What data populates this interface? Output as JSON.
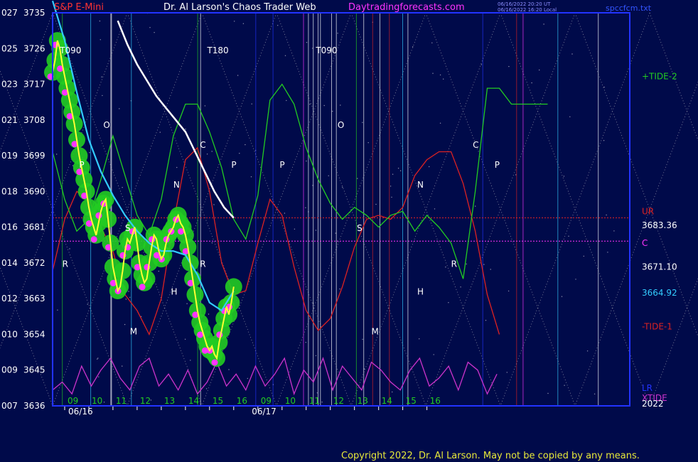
{
  "header": {
    "symbol": "S&P E-Mini",
    "title": "Dr. Al Larson's Chaos Trader Web",
    "site": "Daytradingforecasts.com",
    "stamp_line1": "06/16/2022 20:20 UT",
    "stamp_line2": "06/16/2022 16:20 Local",
    "file": "spccfcm.txt"
  },
  "footer": {
    "copyright": "Copyright 2022, Dr. Al Larson. May not be copied by any means."
  },
  "colors": {
    "background": "#000a4a",
    "plot_border": "#2233ff",
    "price_line": "#ffff33",
    "price_marker": "#ff33ff",
    "price_halo": "#22cc22",
    "ma_cyan": "#33ccff",
    "ma_white": "#ffffff",
    "tide_plus": "#22cc22",
    "tide_minus": "#dd2222",
    "xtide": "#cc33cc"
  },
  "chart_data": {
    "type": "line",
    "title": "S&P E-Mini",
    "xlabel": "",
    "ylabel": "",
    "x_axis": {
      "hour_ticks": [
        "09",
        "10",
        "11",
        "12",
        "13",
        "14",
        "15",
        "16",
        "09",
        "10",
        "11",
        "12",
        "13",
        "14",
        "15",
        "16"
      ],
      "dates": [
        "06/16",
        "06/17"
      ],
      "range_hours": [
        8.5,
        32.4
      ]
    },
    "y_axis": {
      "range": [
        3636,
        3735
      ],
      "ticks": [
        {
          "left": "027",
          "price": "3735",
          "y": 3735
        },
        {
          "left": "025",
          "price": "3726",
          "y": 3726
        },
        {
          "left": "023",
          "price": "3717",
          "y": 3717
        },
        {
          "left": "021",
          "price": "3708",
          "y": 3708
        },
        {
          "left": "019",
          "price": "3699",
          "y": 3699
        },
        {
          "left": "018",
          "price": "3690",
          "y": 3690
        },
        {
          "left": "016",
          "price": "3681",
          "y": 3681
        },
        {
          "left": "014",
          "price": "3672",
          "y": 3672
        },
        {
          "left": "012",
          "price": "3663",
          "y": 3663
        },
        {
          "left": "010",
          "price": "3654",
          "y": 3654
        },
        {
          "left": "009",
          "price": "3645",
          "y": 3645
        },
        {
          "left": "007",
          "price": "3636",
          "y": 3636
        }
      ]
    },
    "grid": false,
    "vertical_markers": [
      {
        "label": "T090",
        "x": 8.8,
        "color": "#ffffff"
      },
      {
        "label": "T180",
        "x": 14.9,
        "color": "#ffffff"
      },
      {
        "label": "T090",
        "x": 19.4,
        "color": "#ffffff"
      }
    ],
    "turn_labels": [
      {
        "label": "O",
        "x": 10.6,
        "y": 3706
      },
      {
        "label": "P",
        "x": 9.6,
        "y": 3696
      },
      {
        "label": "S",
        "x": 11.5,
        "y": 3680
      },
      {
        "label": "N",
        "x": 13.5,
        "y": 3691
      },
      {
        "label": "H",
        "x": 13.4,
        "y": 3664
      },
      {
        "label": "M",
        "x": 11.7,
        "y": 3654
      },
      {
        "label": "R",
        "x": 8.9,
        "y": 3671
      },
      {
        "label": "C",
        "x": 14.6,
        "y": 3701
      },
      {
        "label": "R",
        "x": 14.6,
        "y": 3671
      },
      {
        "label": "P",
        "x": 15.9,
        "y": 3696
      },
      {
        "label": "P",
        "x": 17.9,
        "y": 3696
      },
      {
        "label": "O",
        "x": 20.3,
        "y": 3706
      },
      {
        "label": "S",
        "x": 21.1,
        "y": 3680
      },
      {
        "label": "M",
        "x": 21.7,
        "y": 3654
      },
      {
        "label": "N",
        "x": 23.6,
        "y": 3691
      },
      {
        "label": "H",
        "x": 23.6,
        "y": 3664
      },
      {
        "label": "R",
        "x": 25.0,
        "y": 3671
      },
      {
        "label": "C",
        "x": 25.9,
        "y": 3701
      },
      {
        "label": "P",
        "x": 26.8,
        "y": 3696
      }
    ],
    "right_labels": [
      {
        "label": "+TIDE-2",
        "y": 3719,
        "color": "#22cc22"
      },
      {
        "label": "UR",
        "y": 3685,
        "color": "#dd2222"
      },
      {
        "label": "3683.36",
        "y": 3681.5,
        "color": "#ffffff"
      },
      {
        "label": "C",
        "y": 3677,
        "color": "#ff33ff"
      },
      {
        "label": "3671.10",
        "y": 3671,
        "color": "#ffffff"
      },
      {
        "label": "3664.92",
        "y": 3664.5,
        "color": "#33ccff"
      },
      {
        "label": "-TIDE-1",
        "y": 3656,
        "color": "#dd2222"
      },
      {
        "label": "LR",
        "y": 3640.5,
        "color": "#2233ff"
      },
      {
        "label": "XTIDE",
        "y": 3638,
        "color": "#cc33cc"
      },
      {
        "label": "2022",
        "y": 3636.5,
        "color": "#ffffff"
      }
    ],
    "levels": [
      {
        "name": "UR",
        "value": 3683.36,
        "color": "#dd2222"
      },
      {
        "name": "C",
        "value": 3677.5,
        "color": "#ff33ff"
      }
    ],
    "series": [
      {
        "name": "price",
        "color": "#ffff33",
        "x": [
          8.5,
          8.6,
          8.7,
          8.8,
          8.9,
          9.0,
          9.1,
          9.2,
          9.3,
          9.4,
          9.5,
          9.6,
          9.7,
          9.8,
          9.9,
          10.0,
          10.1,
          10.2,
          10.3,
          10.4,
          10.5,
          10.6,
          10.7,
          10.8,
          10.9,
          11.0,
          11.1,
          11.2,
          11.3,
          11.4,
          11.5,
          11.6,
          11.7,
          11.8,
          11.9,
          12.0,
          12.1,
          12.2,
          12.3,
          12.4,
          12.5,
          12.6,
          12.7,
          12.8,
          12.9,
          13.0,
          13.1,
          13.2,
          13.3,
          13.4,
          13.5,
          13.6,
          13.7,
          13.8,
          13.9,
          14.0,
          14.1,
          14.2,
          14.3,
          14.4,
          14.5,
          14.6,
          14.7,
          14.8,
          14.9,
          15.0,
          15.1,
          15.2,
          15.3,
          15.4,
          15.5,
          15.6,
          15.7,
          15.8,
          15.9,
          16.0
        ],
        "y": [
          3720,
          3723,
          3728,
          3726,
          3722,
          3719,
          3716,
          3713,
          3710,
          3707,
          3703,
          3699,
          3696,
          3693,
          3690,
          3686,
          3683,
          3681,
          3679,
          3682,
          3685,
          3687,
          3688,
          3683,
          3677,
          3671,
          3668,
          3665,
          3666,
          3670,
          3675,
          3678,
          3677,
          3679,
          3681,
          3677,
          3672,
          3669,
          3667,
          3668,
          3672,
          3676,
          3679,
          3678,
          3675,
          3673,
          3674,
          3677,
          3679,
          3680,
          3681,
          3683,
          3684,
          3682,
          3681,
          3679,
          3676,
          3672,
          3668,
          3664,
          3660,
          3657,
          3655,
          3653,
          3651,
          3650,
          3651,
          3649,
          3648,
          3652,
          3655,
          3658,
          3661,
          3659,
          3662,
          3666
        ]
      },
      {
        "name": "ma_cyan",
        "color": "#33ccff",
        "x": [
          8.5,
          9.0,
          9.5,
          10.0,
          10.5,
          11.0,
          11.5,
          12.0,
          12.5,
          13.0,
          13.5,
          14.0,
          14.5,
          15.0,
          15.5,
          16.0
        ],
        "y": [
          3738,
          3728,
          3715,
          3703,
          3695,
          3689,
          3684,
          3680,
          3677,
          3675,
          3675,
          3674,
          3669,
          3662,
          3660,
          3664.92
        ]
      },
      {
        "name": "ma_white",
        "color": "#ffffff",
        "x": [
          11.2,
          11.6,
          12.0,
          12.4,
          12.8,
          13.2,
          13.6,
          14.0,
          14.4,
          14.8,
          15.2,
          15.6,
          16.0
        ],
        "y": [
          3733,
          3727,
          3722,
          3718,
          3714,
          3711,
          3708,
          3705,
          3700,
          3695,
          3690,
          3686,
          3683.36
        ]
      },
      {
        "name": "+TIDE-2",
        "color": "#22cc22",
        "x": [
          8.5,
          9.0,
          9.5,
          10.0,
          10.5,
          11.0,
          11.5,
          12.0,
          12.5,
          13.0,
          13.5,
          14.0,
          14.5,
          15.0,
          15.5,
          16.0,
          16.5,
          17.0,
          17.5,
          18.0,
          18.5,
          19.0,
          19.5,
          20.0,
          20.5,
          21.0,
          21.5,
          22.0,
          22.5,
          23.0,
          23.5,
          24.0,
          24.5,
          25.0,
          25.5,
          26.0,
          26.5,
          27.0,
          27.5,
          28.0,
          28.5,
          29.0
        ],
        "y": [
          3700,
          3688,
          3680,
          3683,
          3693,
          3704,
          3694,
          3684,
          3679,
          3688,
          3704,
          3712,
          3712,
          3705,
          3696,
          3683,
          3678,
          3689,
          3713,
          3717,
          3712,
          3701,
          3693,
          3687,
          3683,
          3686,
          3684,
          3681,
          3684,
          3685,
          3680,
          3684,
          3681,
          3677,
          3668,
          3690,
          3716,
          3716,
          3712,
          3712,
          3712,
          3712
        ]
      },
      {
        "name": "-TIDE-1",
        "color": "#dd2222",
        "x": [
          8.5,
          9.0,
          9.5,
          10.0,
          10.5,
          11.0,
          11.5,
          12.0,
          12.5,
          13.0,
          13.5,
          14.0,
          14.5,
          15.0,
          15.5,
          16.0,
          16.5,
          17.0,
          17.5,
          18.0,
          18.5,
          19.0,
          19.5,
          20.0,
          20.5,
          21.0,
          21.5,
          22.0,
          22.5,
          23.0,
          23.5,
          24.0,
          24.5,
          25.0,
          25.5,
          26.0,
          26.5,
          27.0
        ],
        "y": [
          3670,
          3683,
          3690,
          3688,
          3681,
          3675,
          3664,
          3660,
          3654,
          3663,
          3682,
          3698,
          3701,
          3690,
          3672,
          3664,
          3665,
          3677,
          3688,
          3684,
          3671,
          3660,
          3655,
          3658,
          3666,
          3676,
          3683,
          3684,
          3683,
          3686,
          3694,
          3698,
          3700,
          3700,
          3692,
          3680,
          3664,
          3654
        ]
      },
      {
        "name": "XTIDE",
        "color": "#cc33cc",
        "x": [
          8.5,
          8.9,
          9.3,
          9.7,
          10.1,
          10.5,
          10.9,
          11.3,
          11.7,
          12.1,
          12.5,
          12.9,
          13.3,
          13.7,
          14.1,
          14.5,
          14.9,
          15.3,
          15.7,
          16.1,
          16.5,
          16.9,
          17.3,
          17.7,
          18.1,
          18.5,
          18.9,
          19.3,
          19.7,
          20.1,
          20.5,
          20.9,
          21.3,
          21.7,
          22.1,
          22.5,
          22.9,
          23.3,
          23.7,
          24.1,
          24.5,
          24.9,
          25.3,
          25.7,
          26.1,
          26.5,
          26.9
        ],
        "y": [
          3640,
          3642,
          3639,
          3646,
          3641,
          3645,
          3648,
          3643,
          3640,
          3646,
          3648,
          3641,
          3644,
          3640,
          3645,
          3639,
          3642,
          3647,
          3641,
          3644,
          3640,
          3646,
          3641,
          3644,
          3648,
          3639,
          3645,
          3642,
          3648,
          3640,
          3646,
          3643,
          3640,
          3647,
          3645,
          3642,
          3640,
          3645,
          3648,
          3641,
          3643,
          3646,
          3640,
          3647,
          3645,
          3639,
          3644
        ]
      }
    ]
  }
}
